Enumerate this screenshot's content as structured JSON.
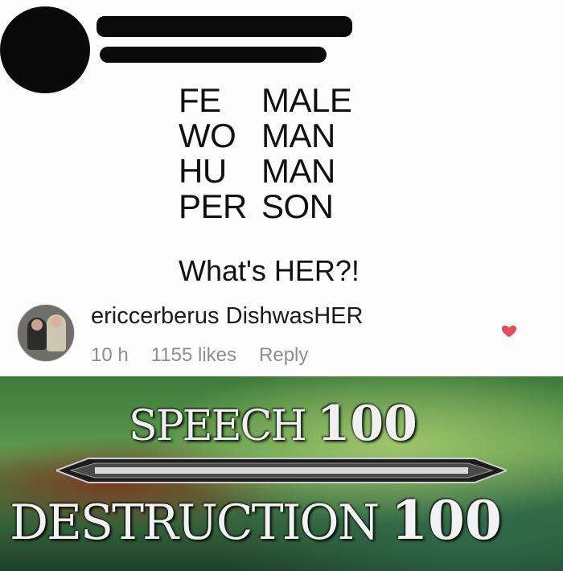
{
  "post": {
    "redacted": true,
    "grid": [
      [
        "FE",
        "MALE"
      ],
      [
        "WO",
        "MAN"
      ],
      [
        "HU",
        "MAN"
      ],
      [
        "PER",
        "SON"
      ]
    ],
    "question": "What's HER?!"
  },
  "comment": {
    "username": "ericcerberus",
    "text": "DishwasHER",
    "time": "10 h",
    "likes": "1155 likes",
    "reply": "Reply",
    "heart_color": "#e0505c"
  },
  "banner": {
    "top_skill": "SPEECH",
    "top_level": "100",
    "bottom_skill": "DESTRUCTION",
    "bottom_level": "100"
  }
}
